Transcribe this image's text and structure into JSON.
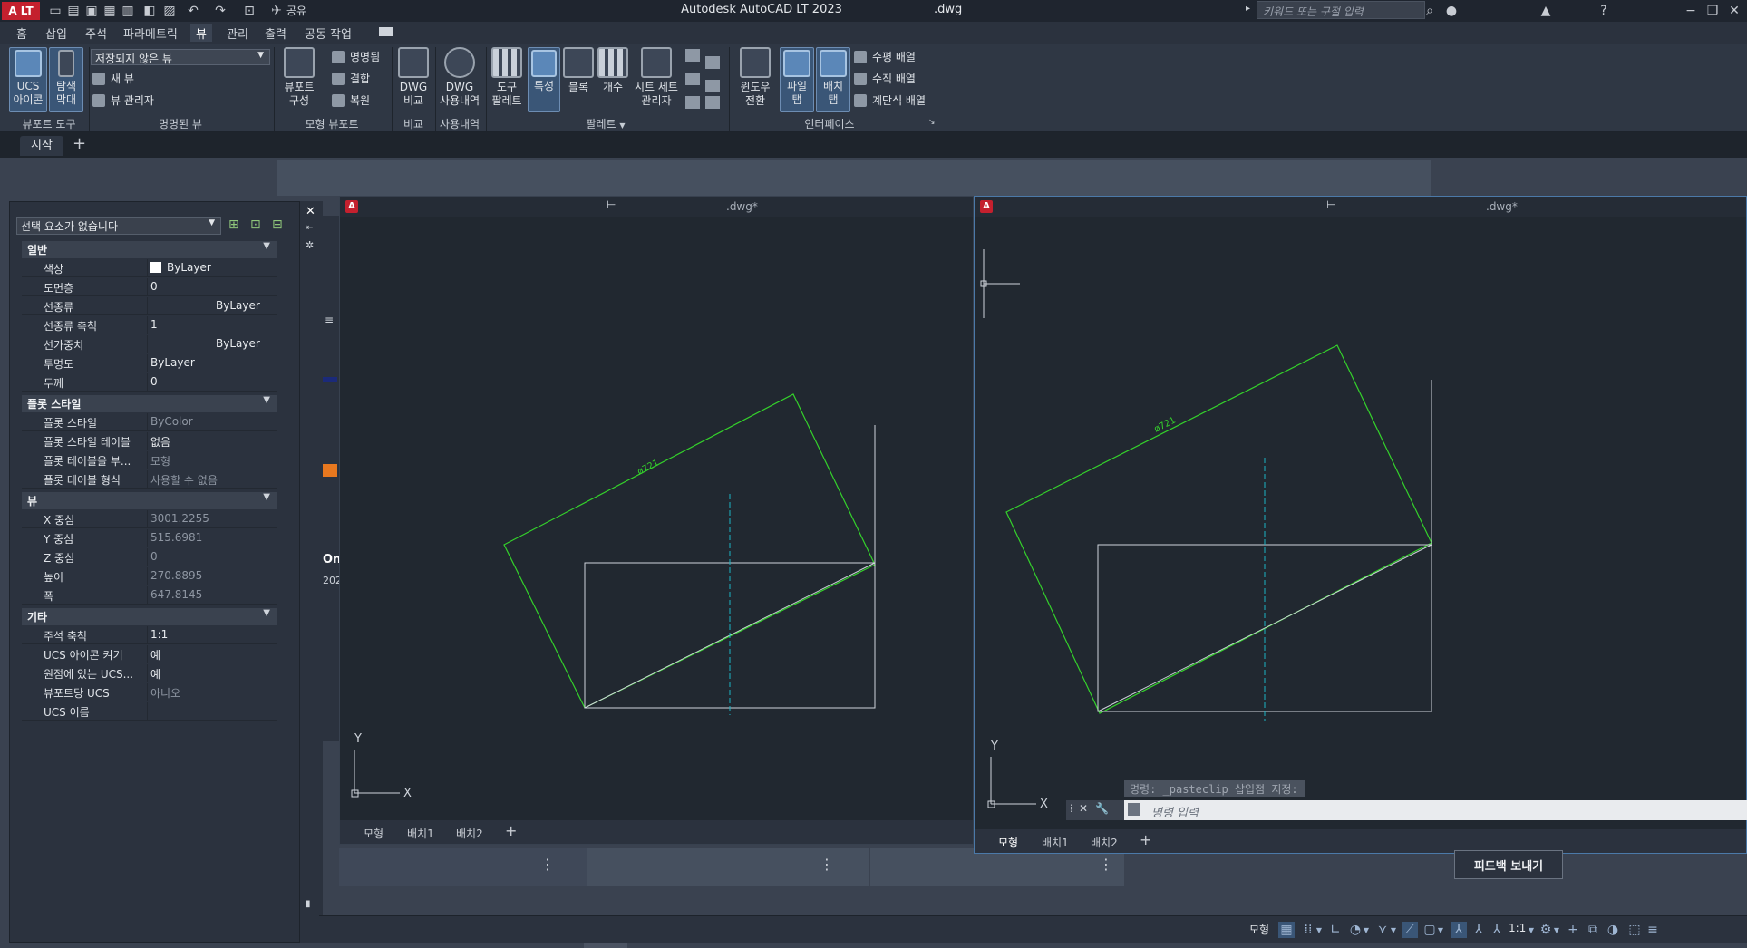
{
  "titlebar": {
    "logo": "A LT",
    "share_label": "공유",
    "title": "Autodesk AutoCAD LT 2023",
    "file": ".dwg",
    "search_placeholder": "키워드 또는 구절 입력"
  },
  "menu": {
    "tabs": [
      "홈",
      "삽입",
      "주석",
      "파라메트릭",
      "뷰",
      "관리",
      "출력",
      "공동 작업"
    ],
    "active": "뷰"
  },
  "ribbon": {
    "viewport_tools": {
      "ucs_icon": "UCS\n아이콘",
      "nav_bar": "탐색\n막대",
      "label": "뷰포트 도구"
    },
    "named_views": {
      "dropdown": "저장되지 않은 뷰",
      "new_view": "새 뷰",
      "view_manager": "뷰 관리자",
      "label": "명명된 뷰"
    },
    "model_viewports": {
      "config": "뷰포트\n구성",
      "named": "명명됨",
      "join": "결합",
      "restore": "복원",
      "label": "모형 뷰포트"
    },
    "compare": {
      "dwg_compare": "DWG\n비교",
      "label": "비교"
    },
    "history": {
      "dwg_history": "DWG\n사용내역",
      "label": "사용내역"
    },
    "palettes": {
      "tool_palette": "도구\n팔레트",
      "properties": "특성",
      "blocks": "블록",
      "count": "개수",
      "sheet_set": "시트 세트\n관리자",
      "label": "팔레트"
    },
    "interface": {
      "switch_window": "윈도우\n전환",
      "file_tabs": "파일\n탭",
      "layout_tabs": "배치\n탭",
      "tile_h": "수평 배열",
      "tile_v": "수직 배열",
      "cascade": "계단식 배열",
      "label": "인터페이스"
    }
  },
  "doc_tabs": {
    "start": "시작",
    "add": "+"
  },
  "properties": {
    "selection": "선택 요소가 없습니다",
    "sections": [
      {
        "title": "일반",
        "rows": [
          {
            "k": "색상",
            "v": "ByLayer",
            "swatch": true
          },
          {
            "k": "도면층",
            "v": "0"
          },
          {
            "k": "선종류",
            "v": "ByLayer",
            "line": true
          },
          {
            "k": "선종류 축척",
            "v": "1"
          },
          {
            "k": "선가중치",
            "v": "ByLayer",
            "line": true
          },
          {
            "k": "투명도",
            "v": "ByLayer"
          },
          {
            "k": "두께",
            "v": "0"
          }
        ]
      },
      {
        "title": "플롯 스타일",
        "rows": [
          {
            "k": "플롯 스타일",
            "v": "ByColor",
            "dim": true
          },
          {
            "k": "플롯 스타일 테이블",
            "v": "없음"
          },
          {
            "k": "플롯 테이블을 부...",
            "v": "모형",
            "dim": true
          },
          {
            "k": "플롯 테이블 형식",
            "v": "사용할 수 없음",
            "dim": true
          }
        ]
      },
      {
        "title": "뷰",
        "rows": [
          {
            "k": "X 중심",
            "v": "3001.2255",
            "dim": true
          },
          {
            "k": "Y 중심",
            "v": "515.6981",
            "dim": true
          },
          {
            "k": "Z 중심",
            "v": "0",
            "dim": true
          },
          {
            "k": "높이",
            "v": "270.8895",
            "dim": true
          },
          {
            "k": "폭",
            "v": "647.8145",
            "dim": true
          }
        ]
      },
      {
        "title": "기타",
        "rows": [
          {
            "k": "주석 축척",
            "v": "1:1"
          },
          {
            "k": "UCS 아이콘 켜기",
            "v": "예"
          },
          {
            "k": "원점에 있는 UCS...",
            "v": "예"
          },
          {
            "k": "뷰포트당 UCS",
            "v": "아니오",
            "dim": true
          },
          {
            "k": "UCS 이름",
            "v": ""
          }
        ]
      }
    ]
  },
  "viewport_left": {
    "file": ".dwg*",
    "dimension": "ø721",
    "tabs": [
      "모형",
      "배치1",
      "배치2"
    ],
    "add": "+"
  },
  "viewport_right": {
    "file": ".dwg*",
    "dimension": "ø721",
    "tabs": [
      "모형",
      "배치1",
      "배치2"
    ],
    "add": "+",
    "cmd_history": "명령: _pasteclip 삽입점 지정:",
    "cmd_placeholder": "명령 입력"
  },
  "partial_text": {
    "a": "On",
    "b": "202"
  },
  "statusbar": {
    "model": "모형",
    "scale": "1:1"
  },
  "feedback": "피드백 보내기",
  "colors": {
    "green_line": "#34d12b",
    "cyan_axis": "#1bb4c4",
    "white_line": "#cfd4db"
  }
}
